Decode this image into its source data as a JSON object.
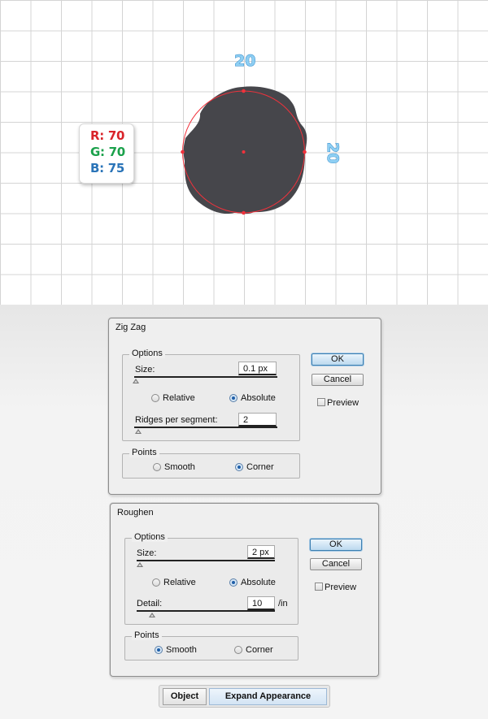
{
  "canvas": {
    "dimension_top": "20",
    "dimension_right": "20",
    "shape_color": "#46464b",
    "guide_color": "#f0323c",
    "rgb": {
      "r": "R: 70",
      "g": "G: 70",
      "b": "B: 75"
    }
  },
  "zigzag": {
    "title": "Zig Zag",
    "options_label": "Options",
    "size_label": "Size:",
    "size_value": "0.1 px",
    "relative_label": "Relative",
    "absolute_label": "Absolute",
    "selected_mode": "Absolute",
    "ridges_label": "Ridges per segment:",
    "ridges_value": "2",
    "points_label": "Points",
    "smooth_label": "Smooth",
    "corner_label": "Corner",
    "selected_points": "Corner",
    "ok_label": "OK",
    "cancel_label": "Cancel",
    "preview_label": "Preview",
    "preview_checked": false
  },
  "roughen": {
    "title": "Roughen",
    "options_label": "Options",
    "size_label": "Size:",
    "size_value": "2 px",
    "relative_label": "Relative",
    "absolute_label": "Absolute",
    "selected_mode": "Absolute",
    "detail_label": "Detail:",
    "detail_value": "10",
    "detail_unit": "/in",
    "points_label": "Points",
    "smooth_label": "Smooth",
    "corner_label": "Corner",
    "selected_points": "Smooth",
    "ok_label": "OK",
    "cancel_label": "Cancel",
    "preview_label": "Preview",
    "preview_checked": false
  },
  "toolbar": {
    "object_label": "Object",
    "expand_label": "Expand Appearance"
  }
}
